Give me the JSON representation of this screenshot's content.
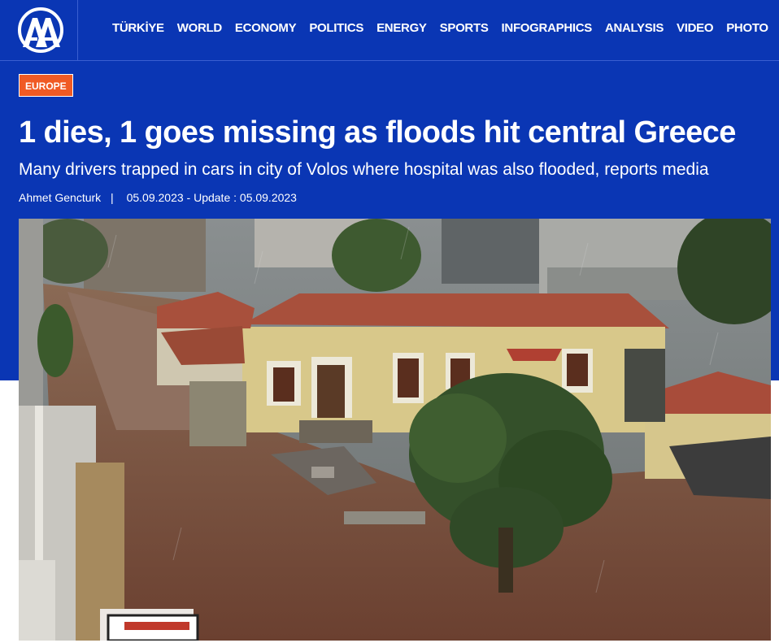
{
  "header": {
    "logo_text": "AA",
    "nav": [
      "TÜRKİYE",
      "WORLD",
      "ECONOMY",
      "POLITICS",
      "ENERGY",
      "SPORTS",
      "INFOGRAPHICS",
      "ANALYSIS",
      "VIDEO",
      "PHOTO"
    ]
  },
  "article": {
    "category": "EUROPE",
    "headline": "1 dies, 1 goes missing as floods hit central Greece",
    "subheadline": "Many drivers trapped in cars in city of Volos where hospital was also flooded, reports media",
    "author": "Ahmet Gencturk",
    "separator": "|",
    "dates": "05.09.2023 - Update : 05.09.2023"
  },
  "colors": {
    "brand_blue": "#0a36b4",
    "badge_orange": "#f05a24"
  }
}
